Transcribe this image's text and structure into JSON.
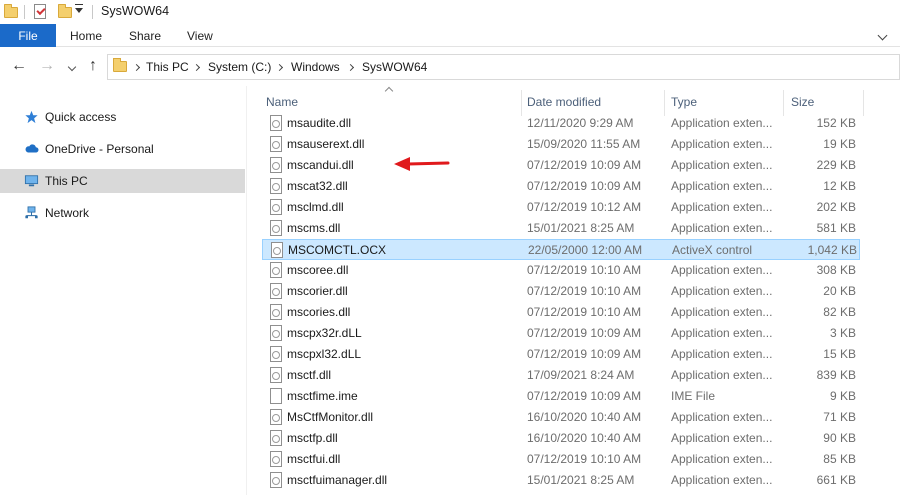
{
  "window": {
    "title": "SysWOW64"
  },
  "ribbon": {
    "tabs": [
      {
        "label": "File"
      },
      {
        "label": "Home"
      },
      {
        "label": "Share"
      },
      {
        "label": "View"
      }
    ]
  },
  "address": {
    "crumbs": [
      "This PC",
      "System (C:)",
      "Windows",
      "SysWOW64"
    ]
  },
  "navpane": {
    "items": [
      {
        "label": "Quick access",
        "icon": "star-icon"
      },
      {
        "label": "OneDrive - Personal",
        "icon": "cloud-icon"
      },
      {
        "label": "This PC",
        "icon": "computer-icon",
        "selected": true
      },
      {
        "label": "Network",
        "icon": "network-icon"
      }
    ]
  },
  "columns": {
    "name": "Name",
    "date": "Date modified",
    "type": "Type",
    "size": "Size"
  },
  "files": [
    {
      "name": "msaudite.dll",
      "date": "12/11/2020 9:29 AM",
      "type": "Application exten...",
      "size": "152 KB"
    },
    {
      "name": "msauserext.dll",
      "date": "15/09/2020 11:55 AM",
      "type": "Application exten...",
      "size": "19 KB"
    },
    {
      "name": "mscandui.dll",
      "date": "07/12/2019 10:09 AM",
      "type": "Application exten...",
      "size": "229 KB"
    },
    {
      "name": "mscat32.dll",
      "date": "07/12/2019 10:09 AM",
      "type": "Application exten...",
      "size": "12 KB"
    },
    {
      "name": "msclmd.dll",
      "date": "07/12/2019 10:12 AM",
      "type": "Application exten...",
      "size": "202 KB"
    },
    {
      "name": "mscms.dll",
      "date": "15/01/2021 8:25 AM",
      "type": "Application exten...",
      "size": "581 KB"
    },
    {
      "name": "MSCOMCTL.OCX",
      "date": "22/05/2000 12:00 AM",
      "type": "ActiveX control",
      "size": "1,042 KB",
      "highlighted": true
    },
    {
      "name": "mscoree.dll",
      "date": "07/12/2019 10:10 AM",
      "type": "Application exten...",
      "size": "308 KB"
    },
    {
      "name": "mscorier.dll",
      "date": "07/12/2019 10:10 AM",
      "type": "Application exten...",
      "size": "20 KB"
    },
    {
      "name": "mscories.dll",
      "date": "07/12/2019 10:10 AM",
      "type": "Application exten...",
      "size": "82 KB"
    },
    {
      "name": "mscpx32r.dLL",
      "date": "07/12/2019 10:09 AM",
      "type": "Application exten...",
      "size": "3 KB"
    },
    {
      "name": "mscpxl32.dLL",
      "date": "07/12/2019 10:09 AM",
      "type": "Application exten...",
      "size": "15 KB"
    },
    {
      "name": "msctf.dll",
      "date": "17/09/2021 8:24 AM",
      "type": "Application exten...",
      "size": "839 KB"
    },
    {
      "name": "msctfime.ime",
      "date": "07/12/2019 10:09 AM",
      "type": "IME File",
      "size": "9 KB"
    },
    {
      "name": "MsCtfMonitor.dll",
      "date": "16/10/2020 10:40 AM",
      "type": "Application exten...",
      "size": "71 KB"
    },
    {
      "name": "msctfp.dll",
      "date": "16/10/2020 10:40 AM",
      "type": "Application exten...",
      "size": "90 KB"
    },
    {
      "name": "msctfui.dll",
      "date": "07/12/2019 10:10 AM",
      "type": "Application exten...",
      "size": "85 KB"
    },
    {
      "name": "msctfuimanager.dll",
      "date": "15/01/2021 8:25 AM",
      "type": "Application exten...",
      "size": "661 KB"
    }
  ],
  "colors": {
    "file_tab": "#1b6ac9",
    "selection": "#cce8ff",
    "annotation_arrow": "#e0191c"
  }
}
